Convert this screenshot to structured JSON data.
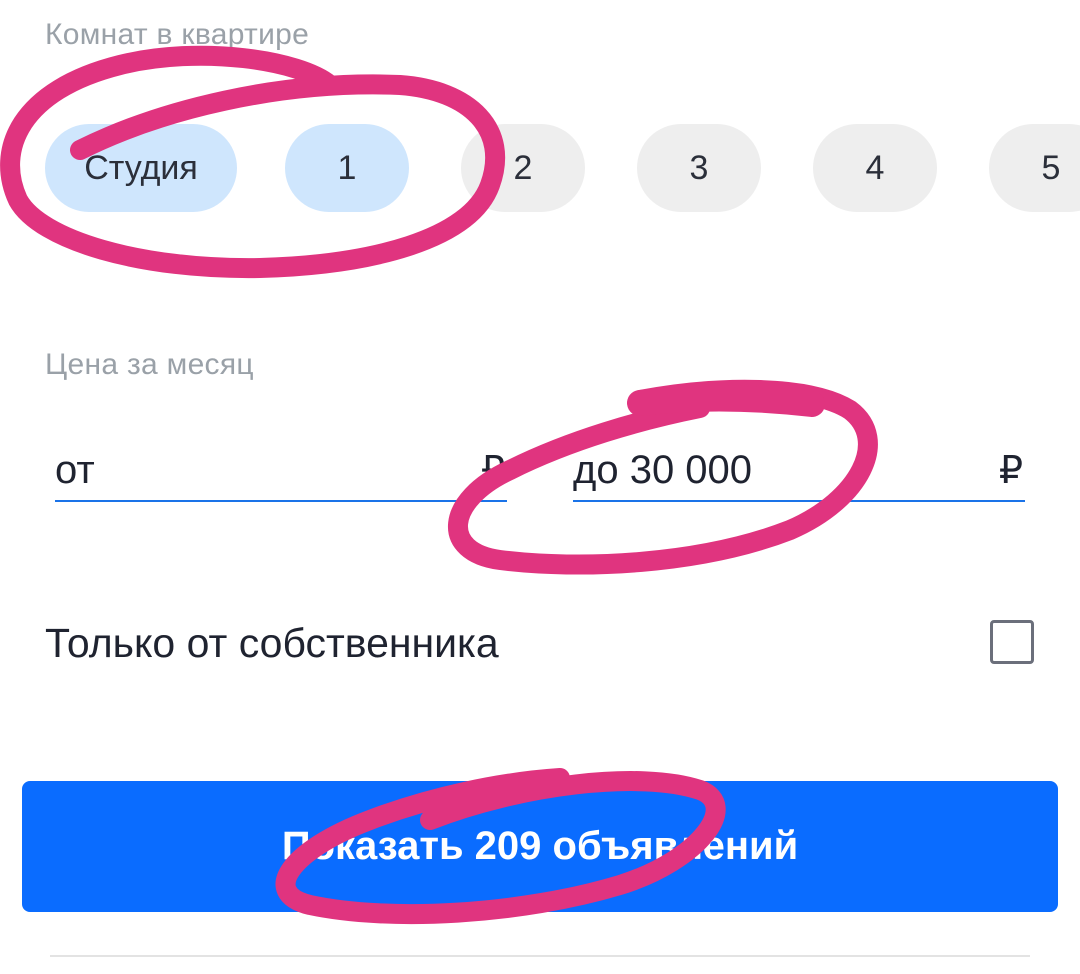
{
  "rooms": {
    "label": "Комнат в квартире",
    "options": [
      {
        "label": "Студия",
        "selected": true
      },
      {
        "label": "1",
        "selected": true
      },
      {
        "label": "2",
        "selected": false
      },
      {
        "label": "3",
        "selected": false
      },
      {
        "label": "4",
        "selected": false
      },
      {
        "label": "5",
        "selected": false
      }
    ]
  },
  "price": {
    "label": "Цена за месяц",
    "from": {
      "value": "от",
      "currency": "₽"
    },
    "to": {
      "value": "до 30 000",
      "currency": "₽"
    }
  },
  "owner_only": {
    "label": "Только от собственника",
    "checked": false
  },
  "show_button": {
    "label": "Показать 209 объявлений"
  },
  "colors": {
    "accent": "#0a6cff",
    "chip_selected": "#cfe6fd",
    "chip_default": "#eeeeee",
    "annotation": "#e0347f"
  }
}
